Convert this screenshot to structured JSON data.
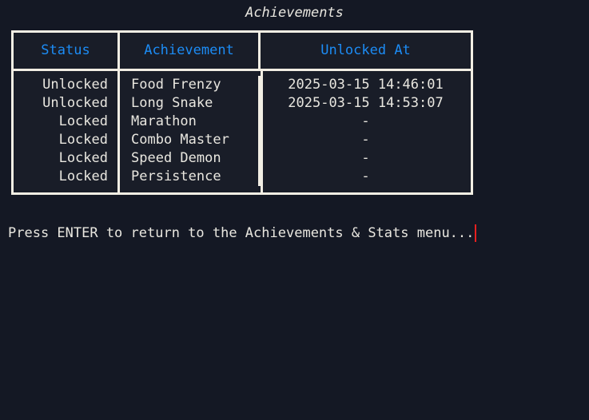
{
  "screen": {
    "background_color": "#141824",
    "text_color": "#e9e7e0",
    "accent_color": "#1c8cf5",
    "border_color": "#f2eee4",
    "cursor_color": "#e8201f"
  },
  "title": "Achievements",
  "table": {
    "columns": [
      {
        "key": "status",
        "label": "Status"
      },
      {
        "key": "achievement",
        "label": "Achievement"
      },
      {
        "key": "unlocked_at",
        "label": "Unlocked At"
      }
    ],
    "rows": [
      {
        "status": "Unlocked",
        "achievement": "Food Frenzy",
        "unlocked_at": "2025-03-15 14:46:01"
      },
      {
        "status": "Unlocked",
        "achievement": "Long Snake",
        "unlocked_at": "2025-03-15 14:53:07"
      },
      {
        "status": "Locked",
        "achievement": "Marathon",
        "unlocked_at": "-"
      },
      {
        "status": "Locked",
        "achievement": "Combo Master",
        "unlocked_at": "-"
      },
      {
        "status": "Locked",
        "achievement": "Speed Demon",
        "unlocked_at": "-"
      },
      {
        "status": "Locked",
        "achievement": "Persistence",
        "unlocked_at": "-"
      }
    ]
  },
  "prompt": {
    "text": "Press ENTER to return to the Achievements & Stats menu..."
  }
}
